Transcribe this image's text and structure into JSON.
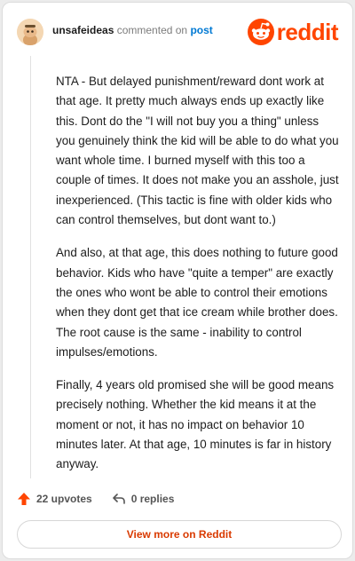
{
  "comment": {
    "username": "unsafeideas",
    "action_text": "commented on",
    "post_link": "post",
    "paragraphs": [
      "NTA - But delayed punishment/reward dont work at that age. It pretty much always ends up exactly like this. Dont do the \"I will not buy you a thing\" unless you genuinely think the kid will be able to do what you want whole time. I burned myself with this too a couple of times. It does not make you an asshole, just inexperienced. (This tactic is fine with older kids who can control themselves, but dont want to.)",
      "And also, at that age, this does nothing to future good behavior. Kids who have \"quite a temper\" are exactly the ones who wont be able to control their emotions when they dont get that ice cream while brother does. The root cause is the same - inability to control impulses/emotions.",
      "Finally, 4 years old promised she will be good means precisely nothing. Whether the kid means it at the moment or not, it has no impact on behavior 10 minutes later. At that age, 10 minutes is far in history anyway."
    ],
    "upvotes_label": "22 upvotes",
    "replies_label": "0 replies"
  },
  "brand": {
    "wordmark": "reddit",
    "color": "#ff4500"
  },
  "footer": {
    "view_more_label": "View more on Reddit"
  },
  "icons": {
    "avatar": "snoo-avatar-icon",
    "logo": "reddit-snoo-icon",
    "upvote": "upvote-arrow-icon",
    "reply": "reply-arrow-icon"
  }
}
